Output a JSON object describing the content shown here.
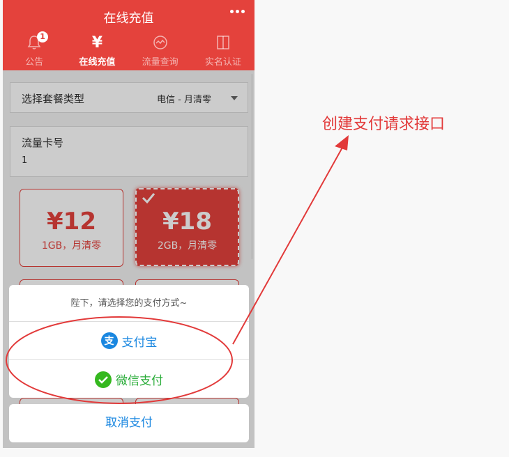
{
  "header": {
    "title": "在线充值"
  },
  "tabs": [
    {
      "label": "公告",
      "icon": "bell-icon",
      "badge": "1"
    },
    {
      "label": "在线充值",
      "icon": "yen-icon"
    },
    {
      "label": "流量查询",
      "icon": "gauge-icon"
    },
    {
      "label": "实名认证",
      "icon": "book-icon"
    }
  ],
  "form": {
    "package_type_label": "选择套餐类型",
    "package_type_value": "电信 - 月清零",
    "card_label": "流量卡号",
    "card_value": "1"
  },
  "packages": [
    {
      "price": "¥12",
      "desc": "1GB，月清零",
      "selected": false
    },
    {
      "price": "¥18",
      "desc": "2GB，月清零",
      "selected": true
    }
  ],
  "payment_sheet": {
    "prompt": "陛下，请选择您的支付方式~",
    "options": [
      {
        "label": "支付宝",
        "icon": "alipay-icon"
      },
      {
        "label": "微信支付",
        "icon": "wechat-icon"
      }
    ],
    "cancel_label": "取消支付"
  },
  "annotation": {
    "text": "创建支付请求接口"
  },
  "colors": {
    "brand_red": "#e4423c",
    "alipay_blue": "#1a87e0",
    "wechat_green": "#2bad3a",
    "annotation_red": "#e23a3a"
  }
}
